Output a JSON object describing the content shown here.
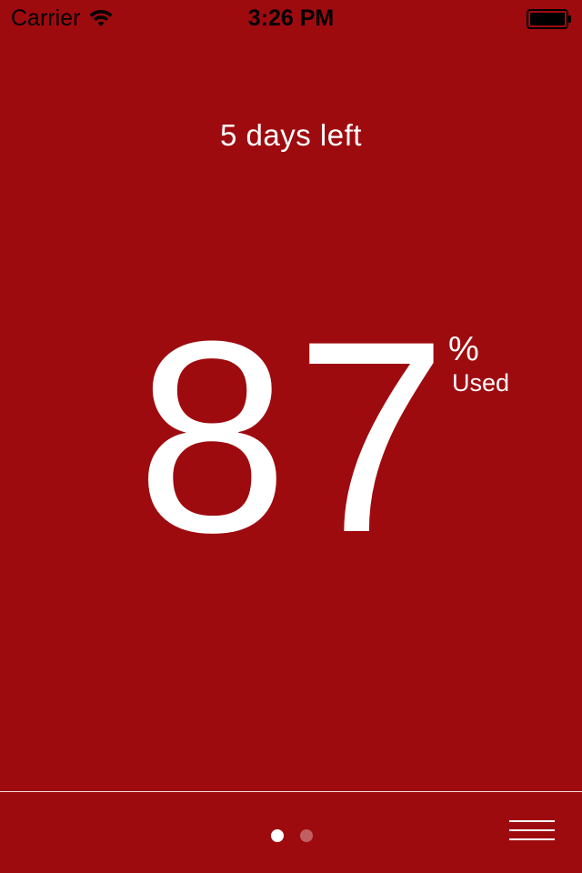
{
  "status_bar": {
    "carrier": "Carrier",
    "time": "3:26 PM",
    "wifi_icon": "wifi-icon",
    "battery_icon": "battery-full-icon",
    "text_color": "#000000"
  },
  "usage": {
    "days_left_text": "5 days left",
    "percent_value": "87",
    "percent_symbol": "%",
    "used_label": "Used",
    "used_fraction": 0.87
  },
  "pager": {
    "page_count": 2,
    "current_page": 1
  },
  "menu": {
    "icon": "hamburger-menu-icon"
  },
  "colors": {
    "background": "#9e0b0f",
    "foreground": "#ffffff"
  }
}
